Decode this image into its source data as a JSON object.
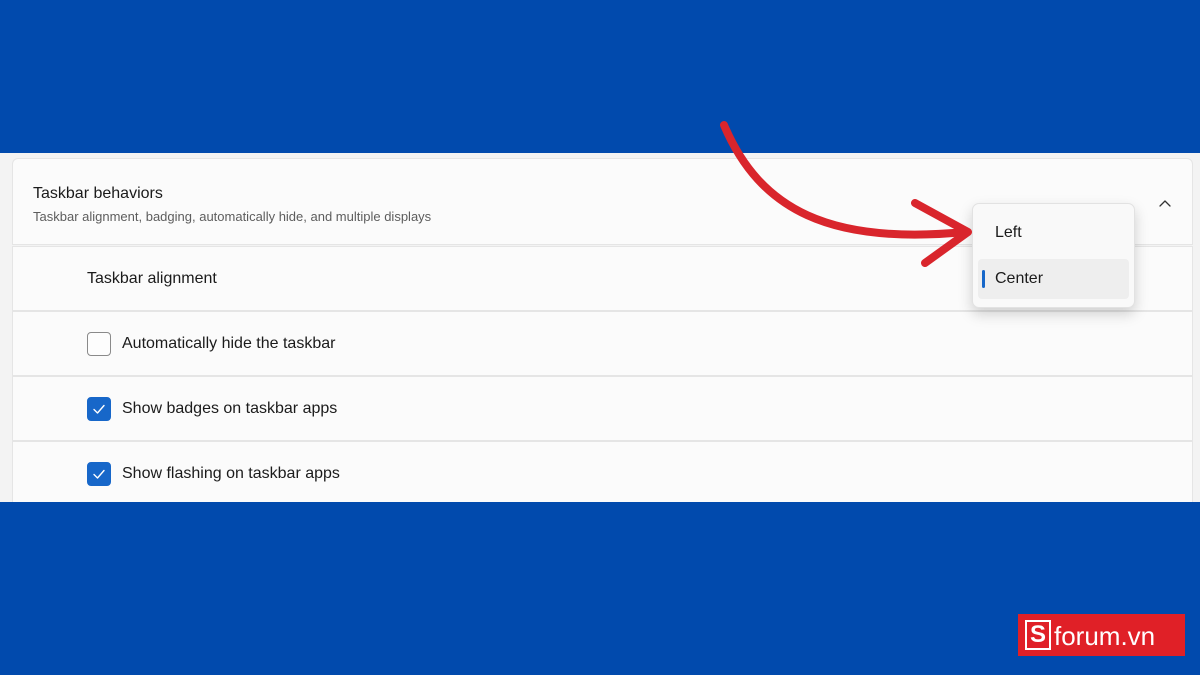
{
  "colors": {
    "background_blue": "#014AAD",
    "accent": "#1767C9",
    "arrow_red": "#D9252C",
    "logo_red": "#E02027"
  },
  "section": {
    "title": "Taskbar behaviors",
    "subtitle": "Taskbar alignment, badging, automatically hide, and multiple displays",
    "expanded": true,
    "toggle_icon": "chevron-up-icon"
  },
  "alignment": {
    "label": "Taskbar alignment",
    "options": [
      "Left",
      "Center"
    ],
    "selected": "Center"
  },
  "checkboxes": [
    {
      "label": "Automatically hide the taskbar",
      "checked": false
    },
    {
      "label": "Show badges on taskbar apps",
      "checked": true
    },
    {
      "label": "Show flashing on taskbar apps",
      "checked": true
    }
  ],
  "logo": {
    "letter": "S",
    "text": "forum.vn"
  }
}
